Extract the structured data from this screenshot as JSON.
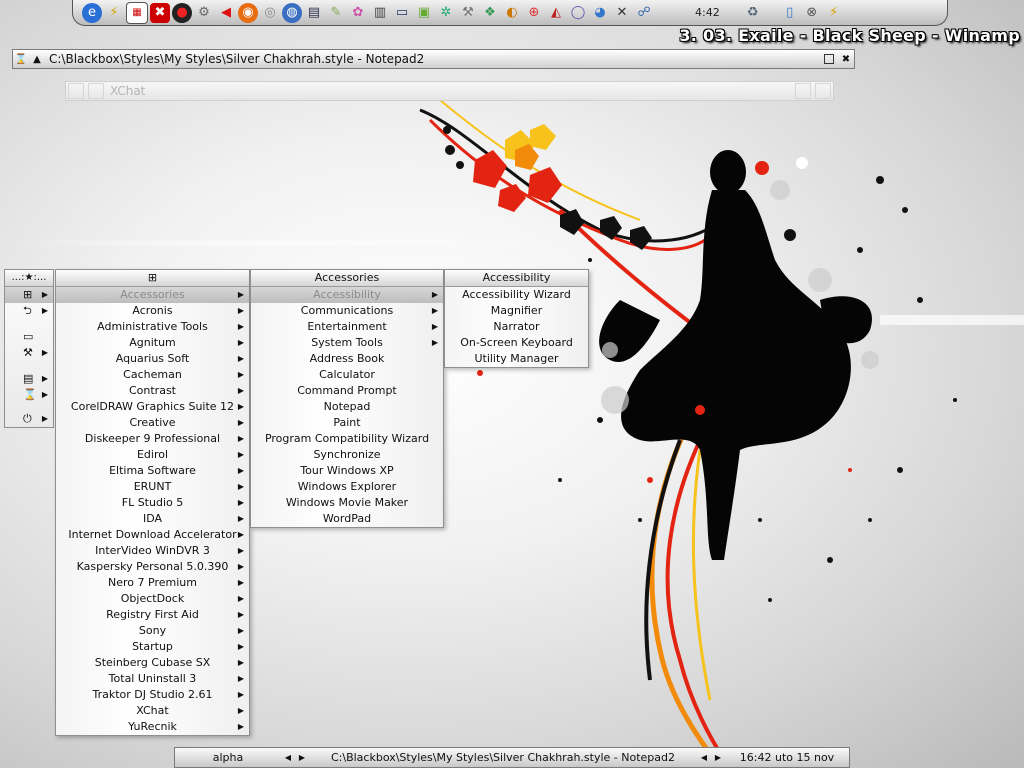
{
  "colors": {
    "accent_red": "#e32412",
    "accent_orange": "#f28a0a",
    "accent_yellow": "#f7c21b",
    "ink": "#000000"
  },
  "dock": {
    "icons": [
      "browser-icon",
      "flash-icon",
      "calendar-icon",
      "bbstyle-icon",
      "record-icon",
      "tools-icon",
      "media-icon",
      "firefox-icon",
      "disc-icon",
      "cd-icon",
      "drive-icon",
      "pencil-icon",
      "paint-icon",
      "film-icon",
      "monitor-icon",
      "picture-icon",
      "gear-icon",
      "wrench-icon",
      "apps-icon",
      "globe-icon",
      "lifebuoy-icon",
      "shield-icon",
      "aim-icon",
      "network-icon",
      "close-icon",
      "chat-icon"
    ],
    "clock": "4:42"
  },
  "now_playing": "3. 03. Exaile - Black Sheep - Winamp",
  "notepad_window": {
    "title": "C:\\Blackbox\\Styles\\My Styles\\Silver Chakhrah.style - Notepad2"
  },
  "xchat_window": {
    "title": "XChat"
  },
  "toolbar_menu": {
    "title": "...:★:..."
  },
  "programs_menu": {
    "title": "⊞",
    "items": [
      "Accessories",
      "Acronis",
      "Administrative Tools",
      "Agnitum",
      "Aquarius Soft",
      "Cacheman",
      "Contrast",
      "CorelDRAW Graphics Suite 12",
      "Creative",
      "Diskeeper 9 Professional",
      "Edirol",
      "Eltima Software",
      "ERUNT",
      "FL Studio 5",
      "IDA",
      "Internet Download Accelerator",
      "InterVideo WinDVR 3",
      "Kaspersky Personal 5.0.390",
      "Nero 7 Premium",
      "ObjectDock",
      "Registry First Aid",
      "Sony",
      "Startup",
      "Steinberg Cubase SX",
      "Total Uninstall 3",
      "Traktor DJ Studio 2.61",
      "XChat",
      "YuRecnik"
    ]
  },
  "accessories_menu": {
    "title": "Accessories",
    "items": [
      "Accessibility",
      "Communications",
      "Entertainment",
      "System Tools",
      "Address Book",
      "Calculator",
      "Command Prompt",
      "Notepad",
      "Paint",
      "Program Compatibility Wizard",
      "Synchronize",
      "Tour Windows XP",
      "Windows Explorer",
      "Windows Movie Maker",
      "WordPad"
    ]
  },
  "accessibility_menu": {
    "title": "Accessibility",
    "items": [
      "Accessibility Wizard",
      "Magnifier",
      "Narrator",
      "On-Screen Keyboard",
      "Utility Manager"
    ]
  },
  "taskbar": {
    "workspace": "alpha",
    "task": "C:\\Blackbox\\Styles\\My Styles\\Silver Chakhrah.style - Notepad2",
    "datetime": "16:42 uto 15 nov"
  }
}
